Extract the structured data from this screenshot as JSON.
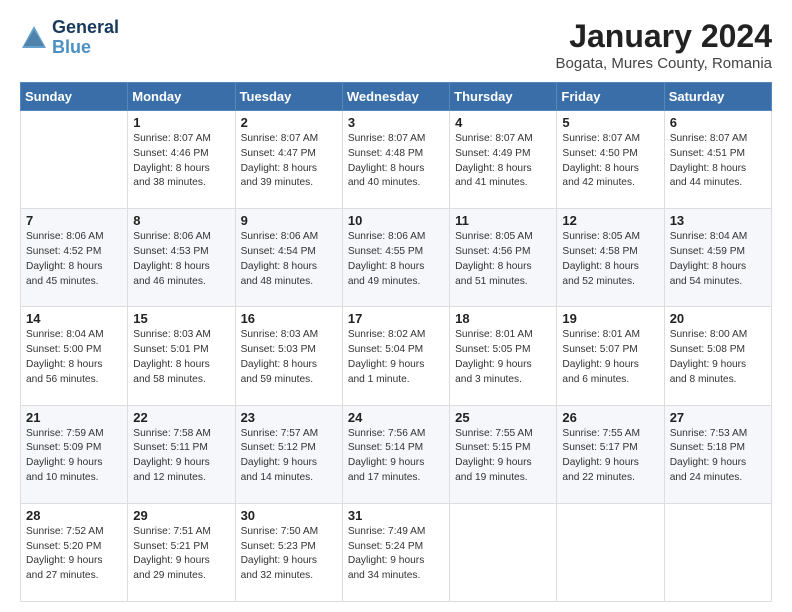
{
  "logo": {
    "line1": "General",
    "line2": "Blue"
  },
  "title": "January 2024",
  "subtitle": "Bogata, Mures County, Romania",
  "days_of_week": [
    "Sunday",
    "Monday",
    "Tuesday",
    "Wednesday",
    "Thursday",
    "Friday",
    "Saturday"
  ],
  "weeks": [
    [
      {
        "num": "",
        "info": ""
      },
      {
        "num": "1",
        "info": "Sunrise: 8:07 AM\nSunset: 4:46 PM\nDaylight: 8 hours\nand 38 minutes."
      },
      {
        "num": "2",
        "info": "Sunrise: 8:07 AM\nSunset: 4:47 PM\nDaylight: 8 hours\nand 39 minutes."
      },
      {
        "num": "3",
        "info": "Sunrise: 8:07 AM\nSunset: 4:48 PM\nDaylight: 8 hours\nand 40 minutes."
      },
      {
        "num": "4",
        "info": "Sunrise: 8:07 AM\nSunset: 4:49 PM\nDaylight: 8 hours\nand 41 minutes."
      },
      {
        "num": "5",
        "info": "Sunrise: 8:07 AM\nSunset: 4:50 PM\nDaylight: 8 hours\nand 42 minutes."
      },
      {
        "num": "6",
        "info": "Sunrise: 8:07 AM\nSunset: 4:51 PM\nDaylight: 8 hours\nand 44 minutes."
      }
    ],
    [
      {
        "num": "7",
        "info": "Sunrise: 8:06 AM\nSunset: 4:52 PM\nDaylight: 8 hours\nand 45 minutes."
      },
      {
        "num": "8",
        "info": "Sunrise: 8:06 AM\nSunset: 4:53 PM\nDaylight: 8 hours\nand 46 minutes."
      },
      {
        "num": "9",
        "info": "Sunrise: 8:06 AM\nSunset: 4:54 PM\nDaylight: 8 hours\nand 48 minutes."
      },
      {
        "num": "10",
        "info": "Sunrise: 8:06 AM\nSunset: 4:55 PM\nDaylight: 8 hours\nand 49 minutes."
      },
      {
        "num": "11",
        "info": "Sunrise: 8:05 AM\nSunset: 4:56 PM\nDaylight: 8 hours\nand 51 minutes."
      },
      {
        "num": "12",
        "info": "Sunrise: 8:05 AM\nSunset: 4:58 PM\nDaylight: 8 hours\nand 52 minutes."
      },
      {
        "num": "13",
        "info": "Sunrise: 8:04 AM\nSunset: 4:59 PM\nDaylight: 8 hours\nand 54 minutes."
      }
    ],
    [
      {
        "num": "14",
        "info": "Sunrise: 8:04 AM\nSunset: 5:00 PM\nDaylight: 8 hours\nand 56 minutes."
      },
      {
        "num": "15",
        "info": "Sunrise: 8:03 AM\nSunset: 5:01 PM\nDaylight: 8 hours\nand 58 minutes."
      },
      {
        "num": "16",
        "info": "Sunrise: 8:03 AM\nSunset: 5:03 PM\nDaylight: 8 hours\nand 59 minutes."
      },
      {
        "num": "17",
        "info": "Sunrise: 8:02 AM\nSunset: 5:04 PM\nDaylight: 9 hours\nand 1 minute."
      },
      {
        "num": "18",
        "info": "Sunrise: 8:01 AM\nSunset: 5:05 PM\nDaylight: 9 hours\nand 3 minutes."
      },
      {
        "num": "19",
        "info": "Sunrise: 8:01 AM\nSunset: 5:07 PM\nDaylight: 9 hours\nand 6 minutes."
      },
      {
        "num": "20",
        "info": "Sunrise: 8:00 AM\nSunset: 5:08 PM\nDaylight: 9 hours\nand 8 minutes."
      }
    ],
    [
      {
        "num": "21",
        "info": "Sunrise: 7:59 AM\nSunset: 5:09 PM\nDaylight: 9 hours\nand 10 minutes."
      },
      {
        "num": "22",
        "info": "Sunrise: 7:58 AM\nSunset: 5:11 PM\nDaylight: 9 hours\nand 12 minutes."
      },
      {
        "num": "23",
        "info": "Sunrise: 7:57 AM\nSunset: 5:12 PM\nDaylight: 9 hours\nand 14 minutes."
      },
      {
        "num": "24",
        "info": "Sunrise: 7:56 AM\nSunset: 5:14 PM\nDaylight: 9 hours\nand 17 minutes."
      },
      {
        "num": "25",
        "info": "Sunrise: 7:55 AM\nSunset: 5:15 PM\nDaylight: 9 hours\nand 19 minutes."
      },
      {
        "num": "26",
        "info": "Sunrise: 7:55 AM\nSunset: 5:17 PM\nDaylight: 9 hours\nand 22 minutes."
      },
      {
        "num": "27",
        "info": "Sunrise: 7:53 AM\nSunset: 5:18 PM\nDaylight: 9 hours\nand 24 minutes."
      }
    ],
    [
      {
        "num": "28",
        "info": "Sunrise: 7:52 AM\nSunset: 5:20 PM\nDaylight: 9 hours\nand 27 minutes."
      },
      {
        "num": "29",
        "info": "Sunrise: 7:51 AM\nSunset: 5:21 PM\nDaylight: 9 hours\nand 29 minutes."
      },
      {
        "num": "30",
        "info": "Sunrise: 7:50 AM\nSunset: 5:23 PM\nDaylight: 9 hours\nand 32 minutes."
      },
      {
        "num": "31",
        "info": "Sunrise: 7:49 AM\nSunset: 5:24 PM\nDaylight: 9 hours\nand 34 minutes."
      },
      {
        "num": "",
        "info": ""
      },
      {
        "num": "",
        "info": ""
      },
      {
        "num": "",
        "info": ""
      }
    ]
  ]
}
